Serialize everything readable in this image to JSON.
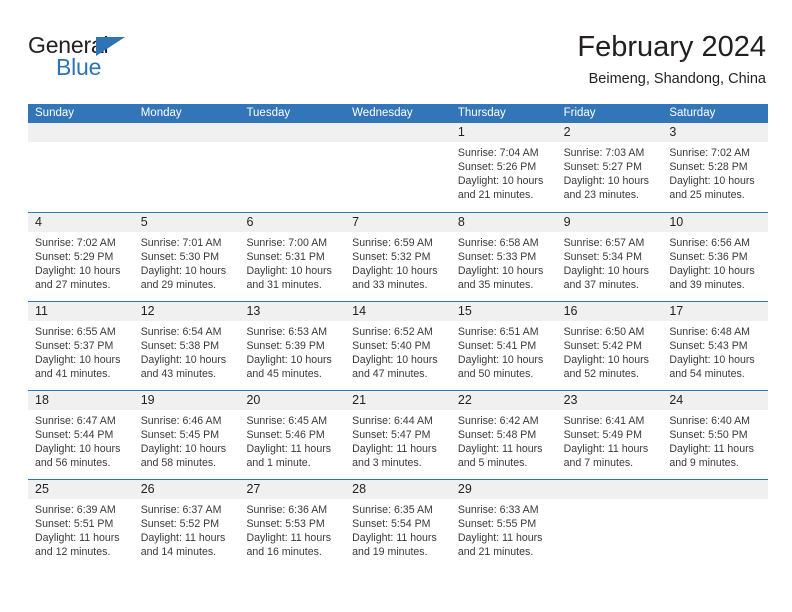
{
  "brand": {
    "name_top": "General",
    "name_bottom": "Blue",
    "triangle_color": "#2e74b5",
    "top_color": "#231f20"
  },
  "header": {
    "title": "February 2024",
    "subtitle": "Beimeng, Shandong, China"
  },
  "theme": {
    "header_blue": "#3275b8",
    "daynum_band": "#f0f0f0",
    "text": "#231f20"
  },
  "calendar": {
    "weekday_headers": [
      "Sunday",
      "Monday",
      "Tuesday",
      "Wednesday",
      "Thursday",
      "Friday",
      "Saturday"
    ],
    "weeks": [
      [
        {
          "day": "",
          "lines": []
        },
        {
          "day": "",
          "lines": []
        },
        {
          "day": "",
          "lines": []
        },
        {
          "day": "",
          "lines": []
        },
        {
          "day": "1",
          "lines": [
            "Sunrise: 7:04 AM",
            "Sunset: 5:26 PM",
            "Daylight: 10 hours",
            "and 21 minutes."
          ]
        },
        {
          "day": "2",
          "lines": [
            "Sunrise: 7:03 AM",
            "Sunset: 5:27 PM",
            "Daylight: 10 hours",
            "and 23 minutes."
          ]
        },
        {
          "day": "3",
          "lines": [
            "Sunrise: 7:02 AM",
            "Sunset: 5:28 PM",
            "Daylight: 10 hours",
            "and 25 minutes."
          ]
        }
      ],
      [
        {
          "day": "4",
          "lines": [
            "Sunrise: 7:02 AM",
            "Sunset: 5:29 PM",
            "Daylight: 10 hours",
            "and 27 minutes."
          ]
        },
        {
          "day": "5",
          "lines": [
            "Sunrise: 7:01 AM",
            "Sunset: 5:30 PM",
            "Daylight: 10 hours",
            "and 29 minutes."
          ]
        },
        {
          "day": "6",
          "lines": [
            "Sunrise: 7:00 AM",
            "Sunset: 5:31 PM",
            "Daylight: 10 hours",
            "and 31 minutes."
          ]
        },
        {
          "day": "7",
          "lines": [
            "Sunrise: 6:59 AM",
            "Sunset: 5:32 PM",
            "Daylight: 10 hours",
            "and 33 minutes."
          ]
        },
        {
          "day": "8",
          "lines": [
            "Sunrise: 6:58 AM",
            "Sunset: 5:33 PM",
            "Daylight: 10 hours",
            "and 35 minutes."
          ]
        },
        {
          "day": "9",
          "lines": [
            "Sunrise: 6:57 AM",
            "Sunset: 5:34 PM",
            "Daylight: 10 hours",
            "and 37 minutes."
          ]
        },
        {
          "day": "10",
          "lines": [
            "Sunrise: 6:56 AM",
            "Sunset: 5:36 PM",
            "Daylight: 10 hours",
            "and 39 minutes."
          ]
        }
      ],
      [
        {
          "day": "11",
          "lines": [
            "Sunrise: 6:55 AM",
            "Sunset: 5:37 PM",
            "Daylight: 10 hours",
            "and 41 minutes."
          ]
        },
        {
          "day": "12",
          "lines": [
            "Sunrise: 6:54 AM",
            "Sunset: 5:38 PM",
            "Daylight: 10 hours",
            "and 43 minutes."
          ]
        },
        {
          "day": "13",
          "lines": [
            "Sunrise: 6:53 AM",
            "Sunset: 5:39 PM",
            "Daylight: 10 hours",
            "and 45 minutes."
          ]
        },
        {
          "day": "14",
          "lines": [
            "Sunrise: 6:52 AM",
            "Sunset: 5:40 PM",
            "Daylight: 10 hours",
            "and 47 minutes."
          ]
        },
        {
          "day": "15",
          "lines": [
            "Sunrise: 6:51 AM",
            "Sunset: 5:41 PM",
            "Daylight: 10 hours",
            "and 50 minutes."
          ]
        },
        {
          "day": "16",
          "lines": [
            "Sunrise: 6:50 AM",
            "Sunset: 5:42 PM",
            "Daylight: 10 hours",
            "and 52 minutes."
          ]
        },
        {
          "day": "17",
          "lines": [
            "Sunrise: 6:48 AM",
            "Sunset: 5:43 PM",
            "Daylight: 10 hours",
            "and 54 minutes."
          ]
        }
      ],
      [
        {
          "day": "18",
          "lines": [
            "Sunrise: 6:47 AM",
            "Sunset: 5:44 PM",
            "Daylight: 10 hours",
            "and 56 minutes."
          ]
        },
        {
          "day": "19",
          "lines": [
            "Sunrise: 6:46 AM",
            "Sunset: 5:45 PM",
            "Daylight: 10 hours",
            "and 58 minutes."
          ]
        },
        {
          "day": "20",
          "lines": [
            "Sunrise: 6:45 AM",
            "Sunset: 5:46 PM",
            "Daylight: 11 hours",
            "and 1 minute."
          ]
        },
        {
          "day": "21",
          "lines": [
            "Sunrise: 6:44 AM",
            "Sunset: 5:47 PM",
            "Daylight: 11 hours",
            "and 3 minutes."
          ]
        },
        {
          "day": "22",
          "lines": [
            "Sunrise: 6:42 AM",
            "Sunset: 5:48 PM",
            "Daylight: 11 hours",
            "and 5 minutes."
          ]
        },
        {
          "day": "23",
          "lines": [
            "Sunrise: 6:41 AM",
            "Sunset: 5:49 PM",
            "Daylight: 11 hours",
            "and 7 minutes."
          ]
        },
        {
          "day": "24",
          "lines": [
            "Sunrise: 6:40 AM",
            "Sunset: 5:50 PM",
            "Daylight: 11 hours",
            "and 9 minutes."
          ]
        }
      ],
      [
        {
          "day": "25",
          "lines": [
            "Sunrise: 6:39 AM",
            "Sunset: 5:51 PM",
            "Daylight: 11 hours",
            "and 12 minutes."
          ]
        },
        {
          "day": "26",
          "lines": [
            "Sunrise: 6:37 AM",
            "Sunset: 5:52 PM",
            "Daylight: 11 hours",
            "and 14 minutes."
          ]
        },
        {
          "day": "27",
          "lines": [
            "Sunrise: 6:36 AM",
            "Sunset: 5:53 PM",
            "Daylight: 11 hours",
            "and 16 minutes."
          ]
        },
        {
          "day": "28",
          "lines": [
            "Sunrise: 6:35 AM",
            "Sunset: 5:54 PM",
            "Daylight: 11 hours",
            "and 19 minutes."
          ]
        },
        {
          "day": "29",
          "lines": [
            "Sunrise: 6:33 AM",
            "Sunset: 5:55 PM",
            "Daylight: 11 hours",
            "and 21 minutes."
          ]
        },
        {
          "day": "",
          "lines": []
        },
        {
          "day": "",
          "lines": []
        }
      ]
    ]
  }
}
